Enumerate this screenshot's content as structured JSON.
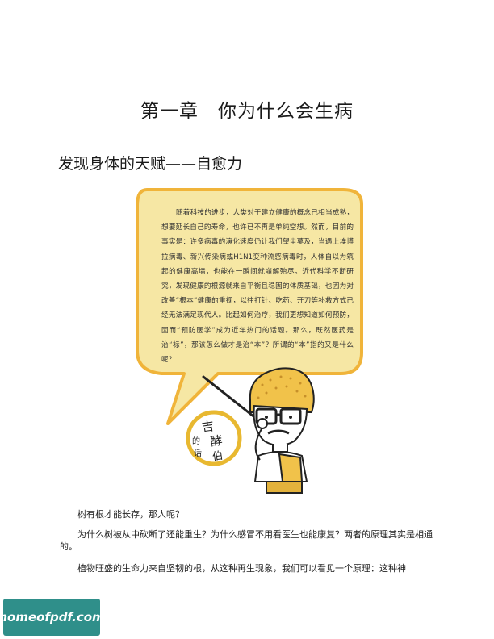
{
  "chapter": {
    "title": "第一章　你为什么会生病"
  },
  "section": {
    "title": "发现身体的天赋——自愈力"
  },
  "speech_bubble": {
    "text": "随着科技的进步，人类对于建立健康的概念已相当成熟，想要延长自己的寿命，也许已不再是单纯空想。然而，目前的事实是：许多病毒的演化速度仍让我们望尘莫及，当遇上埃博拉病毒、新兴传染病或H1N1变种流感病毒时，人体自以为筑起的健康高墙，也能在一瞬间就崩解殆尽。近代科学不断研究，发现健康的根源就来自平衡且稳固的体质基础，也因为对改善“根本”健康的重视，以往打针、吃药、开刀等补救方式已经无法满足现代人。比起如何治疗，我们更想知道如何预防，因而“预防医学”成为近年热门的话题。那么，既然医药是治“标”，那该怎么做才是治“本”？所谓的“本”指的又是什么呢？"
  },
  "signature": {
    "text": "吉酵伯的话"
  },
  "body": {
    "paragraphs": [
      "树有根才能长存，那人呢？",
      "为什么树被从中砍断了还能重生？为什么感冒不用看医生也能康复？两者的原理其实是相通的。",
      "植物旺盛的生命力来自坚韧的根，从这种再生现象，我们可以看见一个原理：这种神"
    ]
  },
  "watermark": {
    "text": "homeofpdf.com"
  },
  "colors": {
    "bubble_fill": "#f6e7a4",
    "bubble_border": "#f0b43a",
    "accent_yellow": "#e8b830",
    "watermark_bg": "#2f8f8a"
  }
}
